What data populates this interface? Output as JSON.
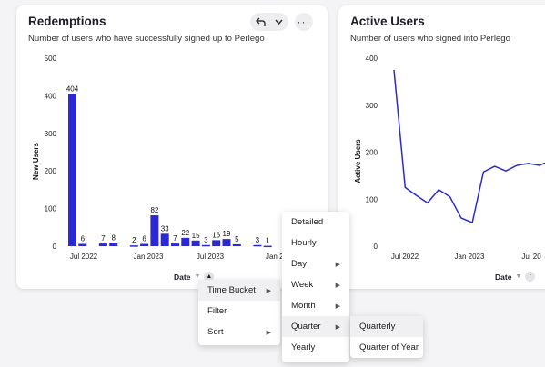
{
  "colors": {
    "accent": "#2b29d6",
    "background": "#f4f4f6"
  },
  "icons": {
    "undo": "arrow-bend-up-left",
    "chevron": "chevron-down",
    "more": "ellipsis-horizontal",
    "submenu": "triangle-right",
    "sort": "arrow-up"
  },
  "redemptions": {
    "title": "Redemptions",
    "subtitle": "Number of users who have successfully signed up to Perlego",
    "x_axis_title": "Date",
    "ellipsis": "···"
  },
  "active_users": {
    "title": "Active Users",
    "subtitle": "Number of users who signed into Perlego",
    "x_axis_title": "Date"
  },
  "chart_data": [
    {
      "type": "bar",
      "ylabel": "New Users",
      "ylim": [
        0,
        500
      ],
      "yticks": [
        0,
        100,
        200,
        300,
        400,
        500
      ],
      "x_tick_labels": [
        "Jul 2022",
        "Jan 2023",
        "Jul 2023",
        "Jan 20"
      ],
      "values": [
        404,
        6,
        null,
        7,
        8,
        null,
        2,
        6,
        82,
        33,
        7,
        22,
        15,
        3,
        16,
        19,
        5,
        null,
        3,
        1
      ],
      "data_labels": [
        "404",
        "6",
        "",
        "7",
        "8",
        "",
        "2",
        "6",
        "82",
        "33",
        "7",
        "22",
        "15",
        "3",
        "16",
        "19",
        "5",
        "",
        "3",
        "1"
      ],
      "grid": false
    },
    {
      "type": "line",
      "ylabel": "Active Users",
      "ylim": [
        0,
        400
      ],
      "yticks": [
        0,
        100,
        200,
        300,
        400
      ],
      "x_tick_labels": [
        "Jul 2022",
        "Jan 2023",
        "Jul 20"
      ],
      "values": [
        375,
        125,
        108,
        92,
        120,
        105,
        60,
        50,
        158,
        170,
        160,
        172,
        176,
        172,
        182
      ],
      "grid": false
    }
  ],
  "menu": {
    "items": [
      "Time Bucket",
      "Filter",
      "Sort"
    ],
    "time_bucket_items": [
      "Detailed",
      "Hourly",
      "Day",
      "Week",
      "Month",
      "Quarter",
      "Yearly"
    ],
    "quarter_items": [
      "Quarterly",
      "Quarter of Year"
    ]
  }
}
